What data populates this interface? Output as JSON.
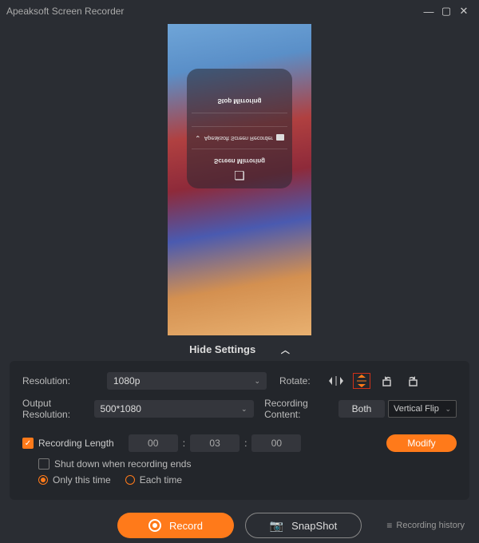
{
  "title": "Apeaksoft Screen Recorder",
  "phone_overlay": {
    "title": "Screen Mirroring",
    "device": "Apeaksoft Screen Recorder",
    "stop": "Stop Mirroring"
  },
  "hide_settings": "Hide Settings",
  "labels": {
    "resolution": "Resolution:",
    "output_resolution": "Output Resolution:",
    "rotate": "Rotate:",
    "recording_content": "Recording Content:"
  },
  "values": {
    "resolution": "1080p",
    "output_resolution": "500*1080",
    "recording_content": "Both",
    "rotate_tooltip": "Vertical Flip"
  },
  "reclen": {
    "label": "Recording Length",
    "hh": "00",
    "mm": "03",
    "ss": "00",
    "modify": "Modify"
  },
  "sub": {
    "shutdown": "Shut down when recording ends",
    "only_this": "Only this time",
    "each_time": "Each time"
  },
  "buttons": {
    "record": "Record",
    "snapshot": "SnapShot",
    "history": "Recording history"
  }
}
